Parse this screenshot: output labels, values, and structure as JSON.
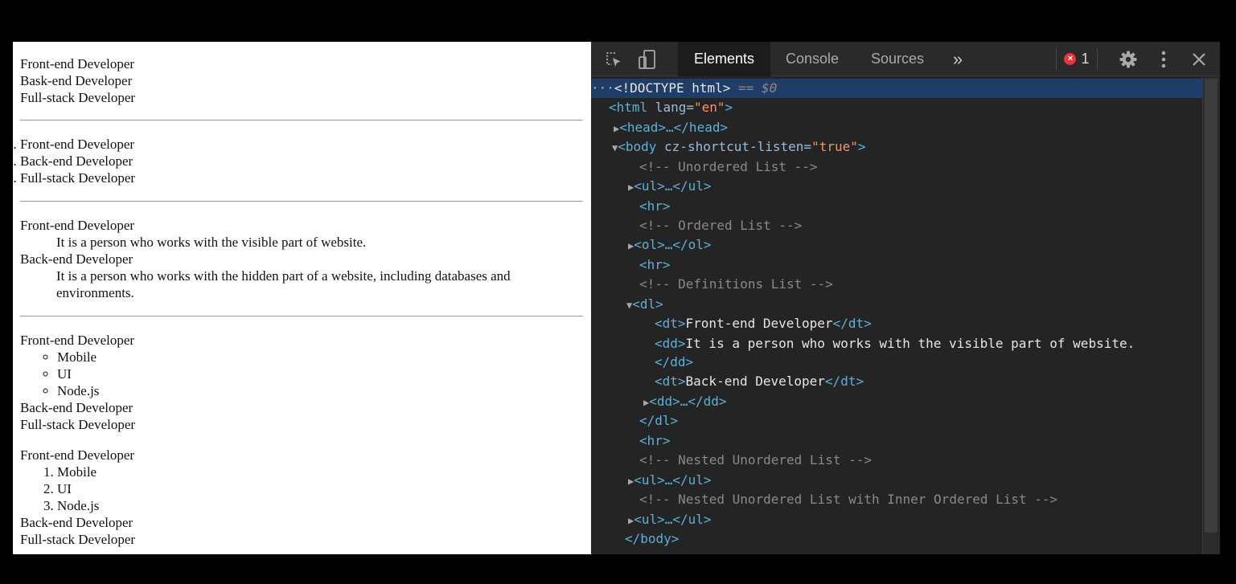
{
  "page": {
    "unordered_list": [
      "Front-end Developer",
      "Bask-end Developer",
      "Full-stack Developer"
    ],
    "ordered_list": [
      "Front-end Developer",
      "Back-end Developer",
      "Full-stack Developer"
    ],
    "definitions": [
      {
        "term": "Front-end Developer",
        "desc": "It is a person who works with the visible part of website."
      },
      {
        "term": "Back-end Developer",
        "desc": "It is a person who works with the hidden part of a website, including databases and environments."
      }
    ],
    "nested_unordered": {
      "first": "Front-end Developer",
      "children": [
        "Mobile",
        "UI",
        "Node.js"
      ],
      "rest": [
        "Back-end Developer",
        "Full-stack Developer"
      ]
    },
    "nested_with_ordered": {
      "first": "Front-end Developer",
      "children": [
        "Mobile",
        "UI",
        "Node.js"
      ],
      "rest": [
        "Back-end Developer",
        "Full-stack Developer"
      ]
    }
  },
  "devtools": {
    "tabs": [
      "Elements",
      "Console",
      "Sources"
    ],
    "more_tabs": "»",
    "error_count": "1",
    "error_glyph": "×",
    "icons": {
      "inspect": "inspect-element-icon",
      "device": "device-toolbar-icon",
      "settings": "gear-icon",
      "menu": "kebab-menu-icon",
      "close": "close-icon"
    },
    "colors": {
      "tag": "#5db0d7",
      "attr_value": "#f29766",
      "comment": "#898989",
      "selection": "#1f3d66",
      "error": "#e8333c"
    },
    "tree": {
      "doctype_dots": "···",
      "doctype": "<!DOCTYPE html>",
      "selected_marker": " == $0",
      "html_open": "<html",
      "html_attr": " lang=",
      "html_val": "\"en\"",
      "html_close": ">",
      "head": "<head>…</head>",
      "body_open": "<body",
      "body_attr": " cz-shortcut-listen=",
      "body_val": "\"true\"",
      "body_close": ">",
      "c_unordered": "<!-- Unordered List -->",
      "ul_collapsed": "<ul>…</ul>",
      "hr": "<hr>",
      "c_ordered": "<!-- Ordered List -->",
      "ol_collapsed": "<ol>…</ol>",
      "c_definitions": "<!-- Definitions List -->",
      "dl_open": "<dl>",
      "dt_open": "<dt>",
      "dt_close": "</dt>",
      "dt1_text": "Front-end Developer",
      "dd_open": "<dd>",
      "dd1_text": "It is a person who works with the visible part of website.",
      "dd_close": "</dd>",
      "dt2_text": "Back-end Developer",
      "dd_collapsed": "<dd>…</dd>",
      "dl_close": "</dl>",
      "c_nested": "<!-- Nested Unordered List -->",
      "c_nested_inner": "<!-- Nested Unordered List with Inner Ordered List -->",
      "body_end": "</body>"
    }
  }
}
